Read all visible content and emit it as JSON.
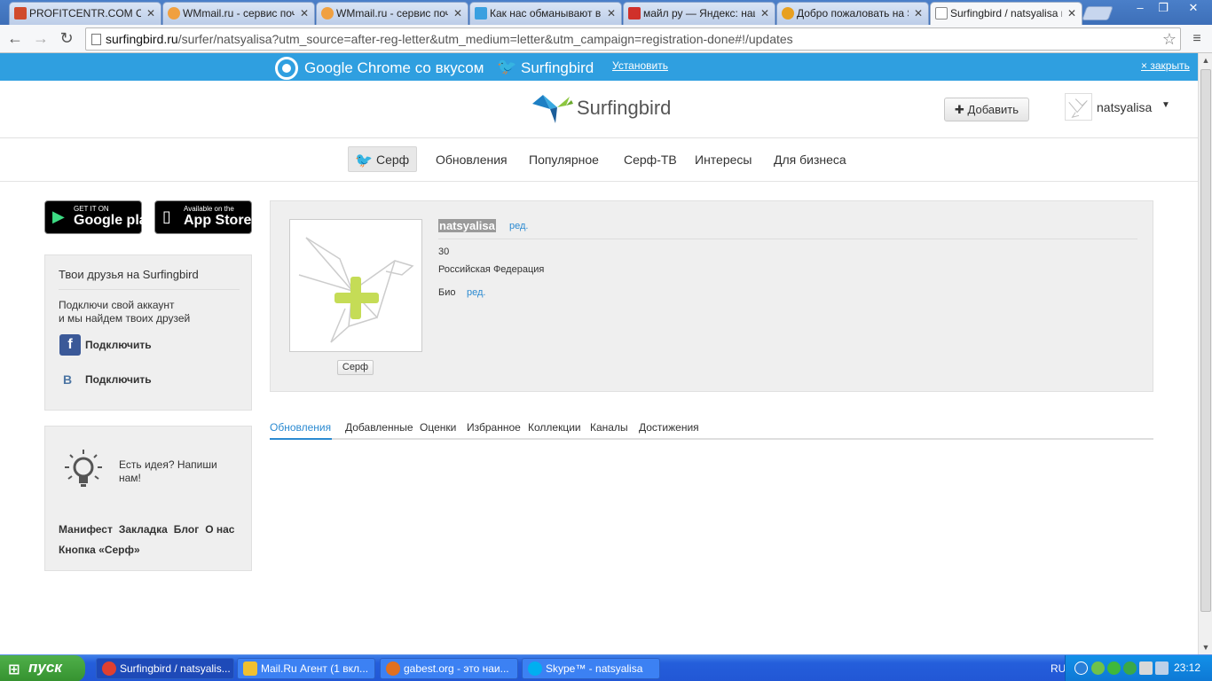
{
  "browser": {
    "tabs": [
      {
        "title": "PROFITCENTR.COM Сис",
        "icon_color": "#d04a2c"
      },
      {
        "title": "WMmail.ru - сервис почт",
        "icon_color": "#f0a040"
      },
      {
        "title": "WMmail.ru - сервис почт",
        "icon_color": "#f0a040"
      },
      {
        "title": "Как нас обманывают в",
        "icon_color": "#3aa0e0"
      },
      {
        "title": "майл ру — Яндекс: наш",
        "icon_color": "#d0302a"
      },
      {
        "title": "Добро пожаловать на S",
        "icon_color": "#e8a020"
      },
      {
        "title": "Surfingbird / natsyalisa н",
        "icon_color": "#ffffff"
      }
    ],
    "url_host": "surfingbird.ru",
    "url_path": "/surfer/natsyalisa?utm_source=after-reg-letter&utm_medium=letter&utm_campaign=registration-done#!/updates"
  },
  "promo": {
    "text": "Google Chrome со вкусом",
    "brand": "Surfingbird",
    "install_label": "Установить",
    "close_label": "× закрыть"
  },
  "header": {
    "brand": "Surfingbird",
    "add_label": "Добавить",
    "username": "natsyalisa"
  },
  "nav": {
    "surf_label": "Серф",
    "items": [
      "Обновления",
      "Популярное",
      "Серф-ТВ",
      "Интересы",
      "Для бизнеса"
    ]
  },
  "stores": {
    "google_small": "GET IT ON",
    "google_big": "Google play",
    "apple_small": "Available on the",
    "apple_big": "App Store"
  },
  "friends": {
    "title": "Твои друзья на Surfingbird",
    "desc": "Подключи свой аккаунт\nи мы найдем твоих друзей",
    "fb_label": "Подключить",
    "vk_label": "Подключить"
  },
  "ideas": {
    "text": "Есть идея? Напиши нам!",
    "links": [
      "Манифест",
      "Закладка",
      "Блог",
      "О нас",
      "Кнопка «Серф»"
    ]
  },
  "profile": {
    "name": "natsyalisa",
    "edit_label": "ред.",
    "age": "30",
    "country": "Российская Федерация",
    "bio_label": "Био",
    "bio_edit_label": "ред.",
    "surf_badge": "Серф"
  },
  "subtabs": [
    "Обновления",
    "Добавленные",
    "Оценки",
    "Избранное",
    "Коллекции",
    "Каналы",
    "Достижения"
  ],
  "taskbar": {
    "start_label": "пуск",
    "items": [
      {
        "label": "Surfingbird / natsyalis...",
        "icon_color": "#e04030"
      },
      {
        "label": "Mail.Ru Агент (1 вкл...",
        "icon_color": "#f0c030"
      },
      {
        "label": "gabest.org - это наи...",
        "icon_color": "#e07020"
      },
      {
        "label": "Skype™ - natsyalisa",
        "icon_color": "#00aff0"
      }
    ],
    "lang": "RU",
    "clock": "23:12"
  }
}
